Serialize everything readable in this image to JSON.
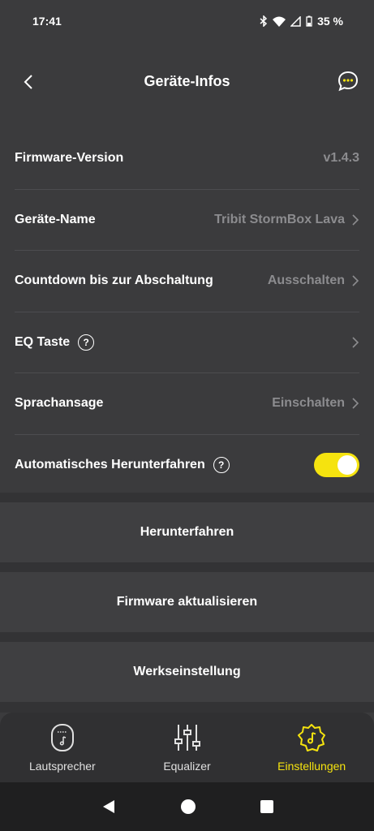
{
  "status": {
    "time": "17:41",
    "battery_text": "35 %"
  },
  "header": {
    "title": "Geräte-Infos",
    "back_icon": "chevron-left-icon",
    "chat_icon": "chat-bubble-icon"
  },
  "settings": {
    "firmware": {
      "label": "Firmware-Version",
      "value": "v1.4.3"
    },
    "device_name": {
      "label": "Geräte-Name",
      "value": "Tribit StormBox Lava"
    },
    "countdown": {
      "label": "Countdown bis zur Abschaltung",
      "value": "Ausschalten"
    },
    "eq_button": {
      "label": "EQ Taste",
      "help": "?"
    },
    "voice_prompt": {
      "label": "Sprachansage",
      "value": "Einschalten"
    },
    "auto_shutdown": {
      "label": "Automatisches Herunterfahren",
      "help": "?",
      "enabled": true
    }
  },
  "actions": {
    "shutdown": "Herunterfahren",
    "update_firmware": "Firmware aktualisieren",
    "factory_reset": "Werkseinstellung"
  },
  "tabs": [
    {
      "label": "Lautsprecher",
      "icon": "speaker-icon",
      "active": false
    },
    {
      "label": "Equalizer",
      "icon": "equalizer-icon",
      "active": false
    },
    {
      "label": "Einstellungen",
      "icon": "settings-gear-icon",
      "active": true
    }
  ],
  "colors": {
    "accent": "#f5e30f",
    "background": "#3b3b3d",
    "secondary_text": "#8c8c8f"
  }
}
